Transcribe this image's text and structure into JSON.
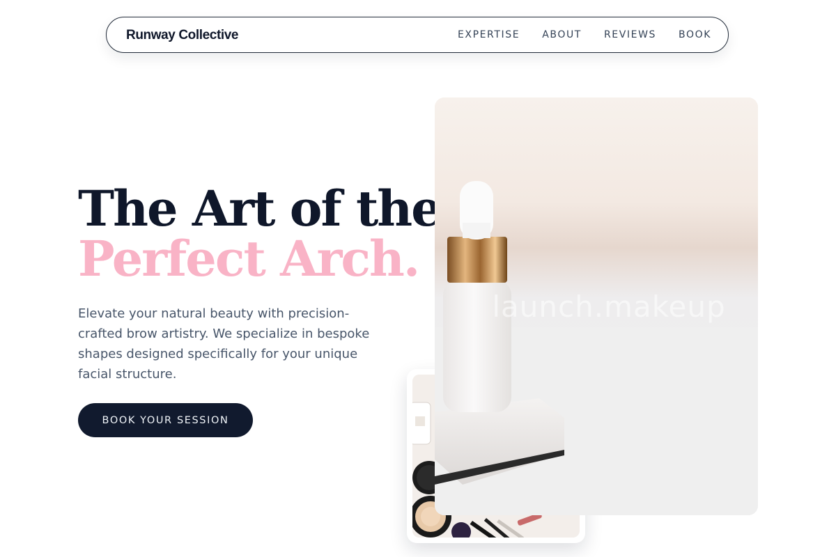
{
  "nav": {
    "brand": "Runway Collective",
    "links": [
      "EXPERTISE",
      "ABOUT",
      "REVIEWS",
      "BOOK"
    ]
  },
  "hero": {
    "headline_line1": "The Art of the",
    "headline_line2": "Perfect Arch.",
    "lead": "Elevate your natural beauty with precision-crafted brow artistry. We specialize in bespoke shapes designed specifically for your unique facial structure.",
    "cta_label": "BOOK YOUR SESSION"
  },
  "media": {
    "watermark": "launch.makeup"
  },
  "colors": {
    "navy": "#0f172a",
    "accent_pink": "#f9b3c6",
    "body_text": "#475569",
    "button_bg": "#111a2e"
  },
  "icons": {
    "main_photo": "serum-dropper-bottle-photo",
    "small_photo": "makeup-products-flatlay-photo"
  }
}
